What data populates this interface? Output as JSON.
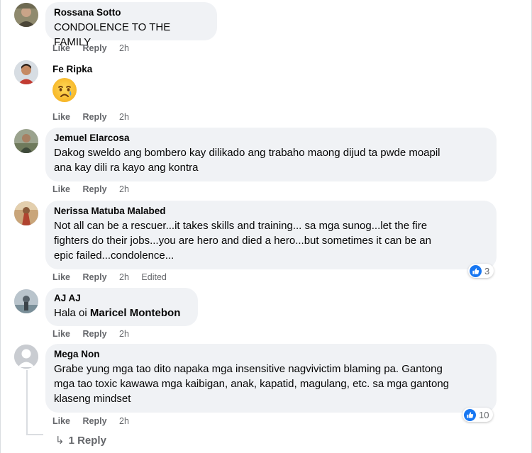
{
  "comments": [
    {
      "author": "Rossana Sotto",
      "text": "CONDOLENCE TO THE FAMILY",
      "actions": {
        "like": "Like",
        "reply": "Reply",
        "time": "2h"
      }
    },
    {
      "author": "Fe Ripka",
      "emoji": "crying-face",
      "actions": {
        "like": "Like",
        "reply": "Reply",
        "time": "2h"
      }
    },
    {
      "author": "Jemuel Elarcosa",
      "text_lines": [
        "Dakog sweldo ang bombero kay dilikado ang trabaho maong dijud ta pwde moapil",
        "ana kay dili ra kayo ang kontra"
      ],
      "actions": {
        "like": "Like",
        "reply": "Reply",
        "time": "2h"
      }
    },
    {
      "author": "Nerissa Matuba Malabed",
      "text_lines": [
        "Not all can be a rescuer...it takes skills and training... sa mga sunog...let the fire",
        "fighters do their jobs...you are hero and died a hero...but sometimes it can be an",
        "epic failed...condolence..."
      ],
      "actions": {
        "like": "Like",
        "reply": "Reply",
        "time": "2h",
        "edited": "Edited"
      },
      "reactions": {
        "icon": "like-icon",
        "count": "3"
      }
    },
    {
      "author": "AJ AJ",
      "text_prefix": "Hala oi ",
      "mention": "Maricel Montebon",
      "actions": {
        "like": "Like",
        "reply": "Reply",
        "time": "2h"
      }
    },
    {
      "author": "Mega Non",
      "text_lines": [
        "Grabe yung mga tao dito napaka mga insensitive nagvivictim blaming pa. Gantong",
        "mga tao toxic kawawa mga kaibigan, anak, kapatid, magulang, etc. sa mga gantong",
        "klaseng mindset"
      ],
      "actions": {
        "like": "Like",
        "reply": "Reply",
        "time": "2h"
      },
      "reactions": {
        "icon": "like-icon",
        "count": "10"
      }
    }
  ],
  "replies_link": {
    "arrow": "↳",
    "label": "1 Reply"
  },
  "colors": {
    "bubble": "#f0f2f5",
    "secondary_text": "#65676b",
    "like_blue": "#1877f2",
    "border": "#dadde1"
  }
}
